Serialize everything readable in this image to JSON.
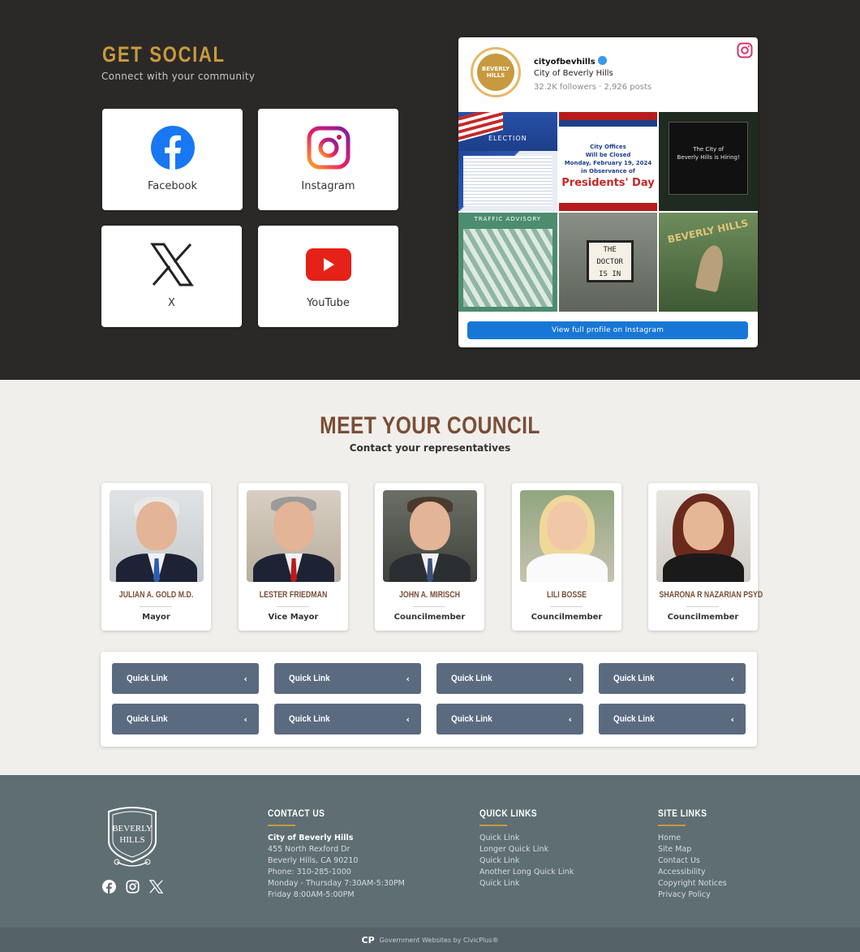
{
  "social": {
    "title": "GET SOCIAL",
    "subtitle": "Connect with your community",
    "cards": [
      {
        "label": "Facebook",
        "icon": "facebook-icon"
      },
      {
        "label": "Instagram",
        "icon": "instagram-icon"
      },
      {
        "label": "X",
        "icon": "x-icon"
      },
      {
        "label": "YouTube",
        "icon": "youtube-icon"
      }
    ],
    "instagram": {
      "handle": "cityofbevhills",
      "name": "City of Beverly Hills",
      "stats": "32.2K followers · 2,926 posts",
      "avatar_text": "BEVERLY HILLS",
      "button": "View full profile on Instagram",
      "tiles": {
        "t1_text": "ELECTION",
        "t2_msg1": "City Offices",
        "t2_msg2": "Will be Closed",
        "t2_msg3": "Monday, February 19, 2024",
        "t2_msg4": "in Observance of",
        "t2_pd": "Presidents' Day",
        "t3_line1": "The City of",
        "t3_line2": "Beverly Hills is Hiring!",
        "t4_hdr": "TRAFFIC ADVISORY",
        "t5_l1": "THE",
        "t5_l2": "DOCTOR",
        "t5_l3": "IS IN",
        "t6_text": "BEVERLY HILLS"
      }
    }
  },
  "council": {
    "title": "MEET YOUR COUNCIL",
    "subtitle": "Contact your representatives",
    "members": [
      {
        "name": "JULIAN A. GOLD M.D.",
        "role": "Mayor"
      },
      {
        "name": "LESTER FRIEDMAN",
        "role": "Vice Mayor"
      },
      {
        "name": "JOHN A. MIRISCH",
        "role": "Councilmember"
      },
      {
        "name": "LILI BOSSE",
        "role": "Councilmember"
      },
      {
        "name": "SHARONA R NAZARIAN PSYD",
        "role": "Councilmember"
      }
    ],
    "quick_links": [
      "Quick Link",
      "Quick Link",
      "Quick Link",
      "Quick Link",
      "Quick Link",
      "Quick Link",
      "Quick Link",
      "Quick Link"
    ]
  },
  "footer": {
    "logo_text_1": "BEVERLY",
    "logo_text_2": "HILLS",
    "contact": {
      "heading": "CONTACT US",
      "org": "City of Beverly Hills",
      "lines": [
        "455 North Rexford Dr",
        "Beverly Hills, CA 90210",
        "Phone: 310-285-1000",
        "Monday - Thursday 7:30AM-5:30PM",
        "Friday 8:00AM-5:00PM"
      ]
    },
    "quick_links": {
      "heading": "QUICK LINKS",
      "items": [
        "Quick Link",
        "Longer Quick Link",
        "Quick Link",
        "Another Long Quick Link",
        "Quick Link"
      ]
    },
    "site_links": {
      "heading": "SITE LINKS",
      "items": [
        "Home",
        "Site Map",
        "Contact Us",
        "Accessibility",
        "Copyright Notices",
        "Privacy Policy"
      ]
    },
    "credit": "Government Websites by CivicPlus®",
    "credit_logo": "CP"
  },
  "colors": {
    "dark_bg": "#2b2927",
    "gold": "#c89a3f",
    "brown": "#7a4e36",
    "quick_link": "#5a6b80",
    "footer": "#5f6e73"
  }
}
